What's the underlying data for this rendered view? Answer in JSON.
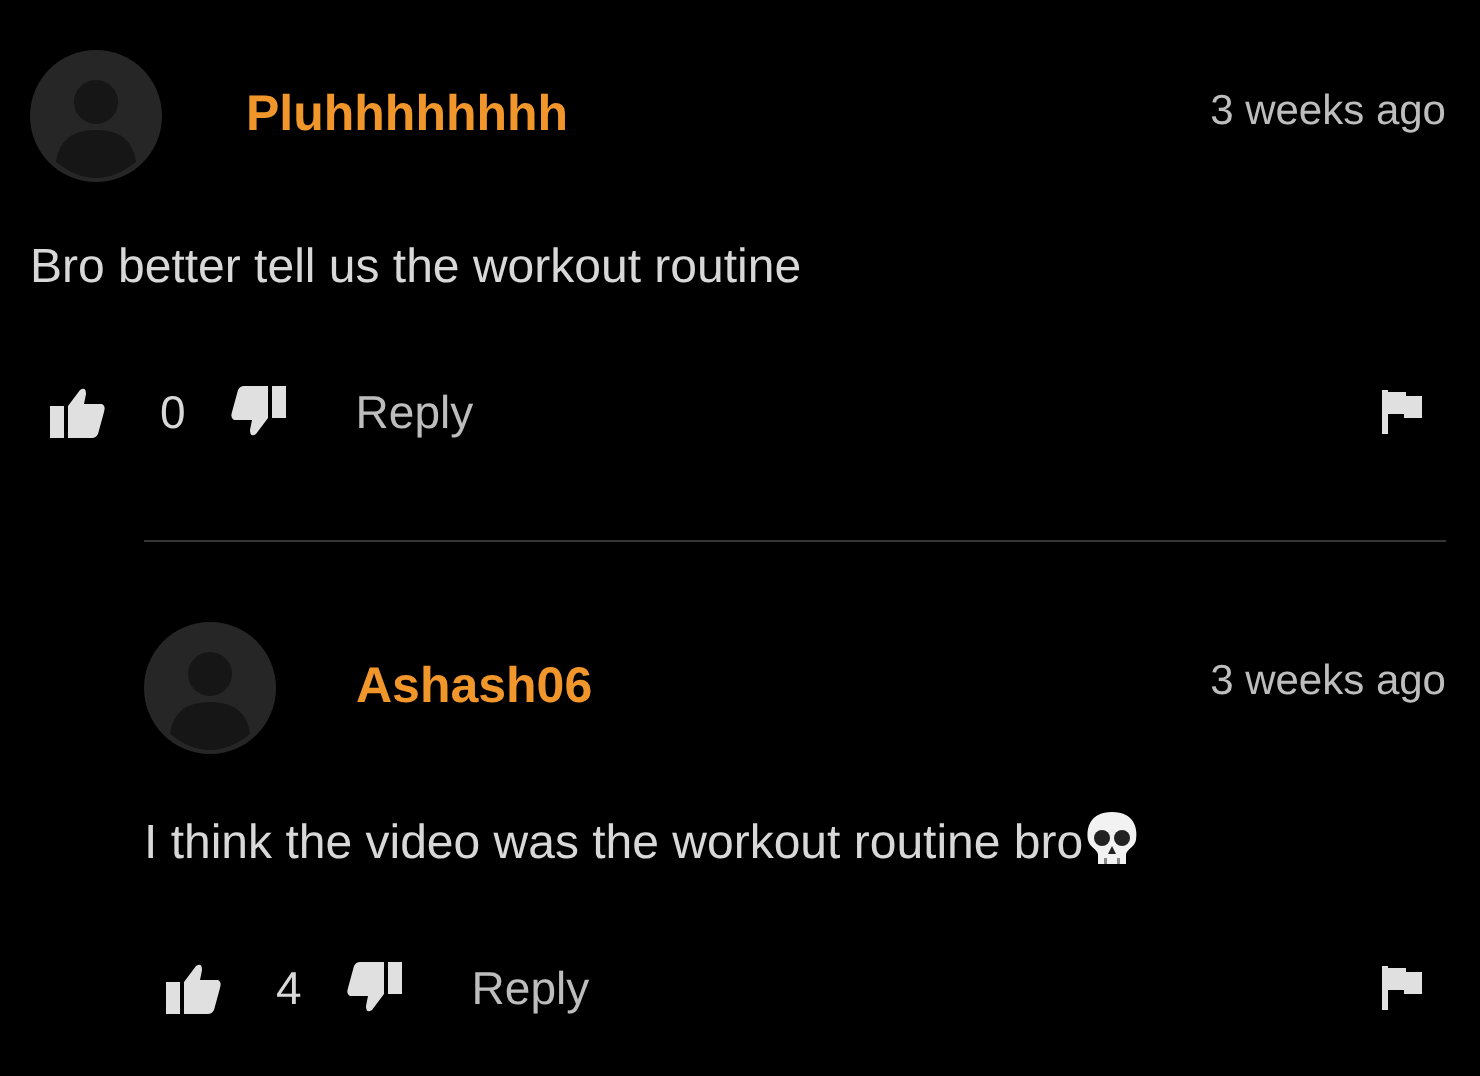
{
  "comments": [
    {
      "username": "Pluhhhhhhhh",
      "time": "3 weeks ago",
      "body": "Bro better tell us the workout routine",
      "body_emoji": false,
      "likes": "0",
      "reply_label": "Reply",
      "children": [
        {
          "username": "Ashash06",
          "time": "3 weeks ago",
          "body": "I think the video was the workout routine bro",
          "body_emoji": true,
          "likes": "4",
          "reply_label": "Reply"
        }
      ]
    }
  ]
}
